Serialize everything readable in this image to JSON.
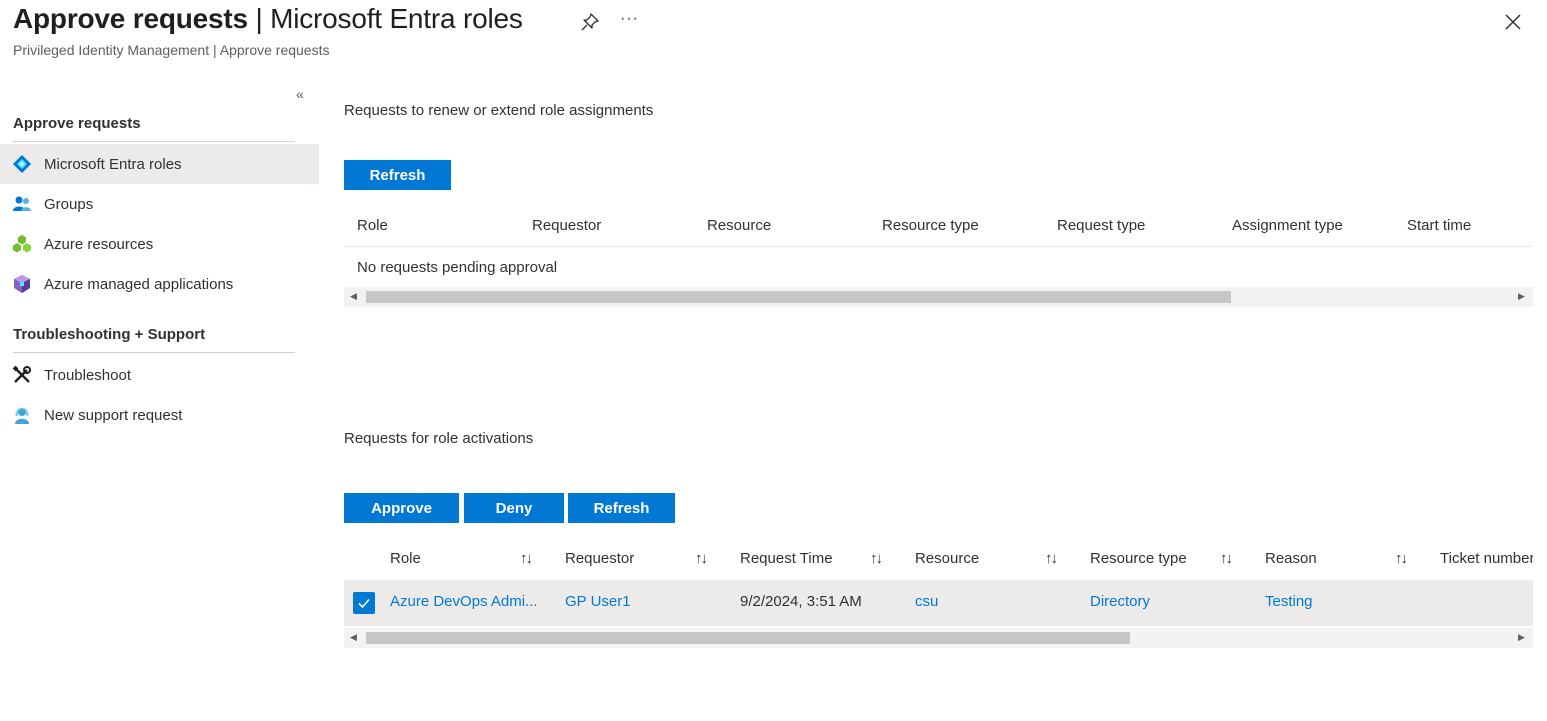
{
  "header": {
    "title_bold": "Approve requests",
    "title_rest": " | Microsoft Entra roles",
    "breadcrumb": "Privileged Identity Management | Approve requests"
  },
  "sidebar": {
    "sections": [
      {
        "title": "Approve requests",
        "items": [
          {
            "label": "Microsoft Entra roles",
            "icon": "entra-roles-icon",
            "active": true
          },
          {
            "label": "Groups",
            "icon": "groups-icon"
          },
          {
            "label": "Azure resources",
            "icon": "azure-resources-icon"
          },
          {
            "label": "Azure managed applications",
            "icon": "managed-apps-icon"
          }
        ]
      },
      {
        "title": "Troubleshooting + Support",
        "items": [
          {
            "label": "Troubleshoot",
            "icon": "troubleshoot-icon"
          },
          {
            "label": "New support request",
            "icon": "support-request-icon"
          }
        ]
      }
    ]
  },
  "renew": {
    "label": "Requests to renew or extend role assignments",
    "refresh_label": "Refresh",
    "columns": [
      "Role",
      "Requestor",
      "Resource",
      "Resource type",
      "Request type",
      "Assignment type",
      "Start time"
    ],
    "empty_message": "No requests pending approval"
  },
  "activations": {
    "label": "Requests for role activations",
    "buttons": {
      "approve": "Approve",
      "deny": "Deny",
      "refresh": "Refresh"
    },
    "columns": [
      "Role",
      "Requestor",
      "Request Time",
      "Resource",
      "Resource type",
      "Reason",
      "Ticket number"
    ],
    "rows": [
      {
        "role": "Azure DevOps Admi...",
        "requestor": "GP User1",
        "request_time": "9/2/2024, 3:51 AM",
        "resource": "csu",
        "resource_type": "Directory",
        "reason": "Testing",
        "selected": true
      }
    ]
  },
  "colors": {
    "accent": "#0078d4",
    "selected_row": "#edebe9"
  }
}
